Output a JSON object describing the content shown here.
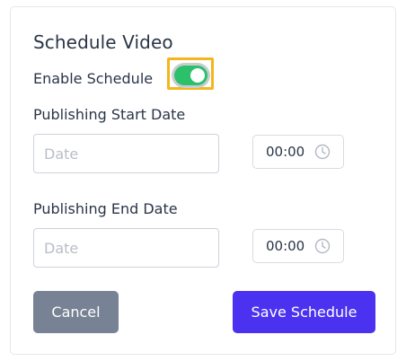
{
  "title": "Schedule Video",
  "enable_schedule": {
    "label": "Enable Schedule",
    "enabled": true,
    "on_color": "#2cc06b",
    "highlight_color": "#f4b51e"
  },
  "start": {
    "label": "Publishing Start Date",
    "date_placeholder": "Date",
    "date_value": "",
    "time_value": "00:00",
    "time_icon": "clock-icon"
  },
  "end": {
    "label": "Publishing End Date",
    "date_placeholder": "Date",
    "date_value": "",
    "time_value": "00:00",
    "time_icon": "clock-icon"
  },
  "buttons": {
    "cancel_label": "Cancel",
    "cancel_color": "#778294",
    "save_label": "Save Schedule",
    "save_color": "#4b32f0"
  }
}
